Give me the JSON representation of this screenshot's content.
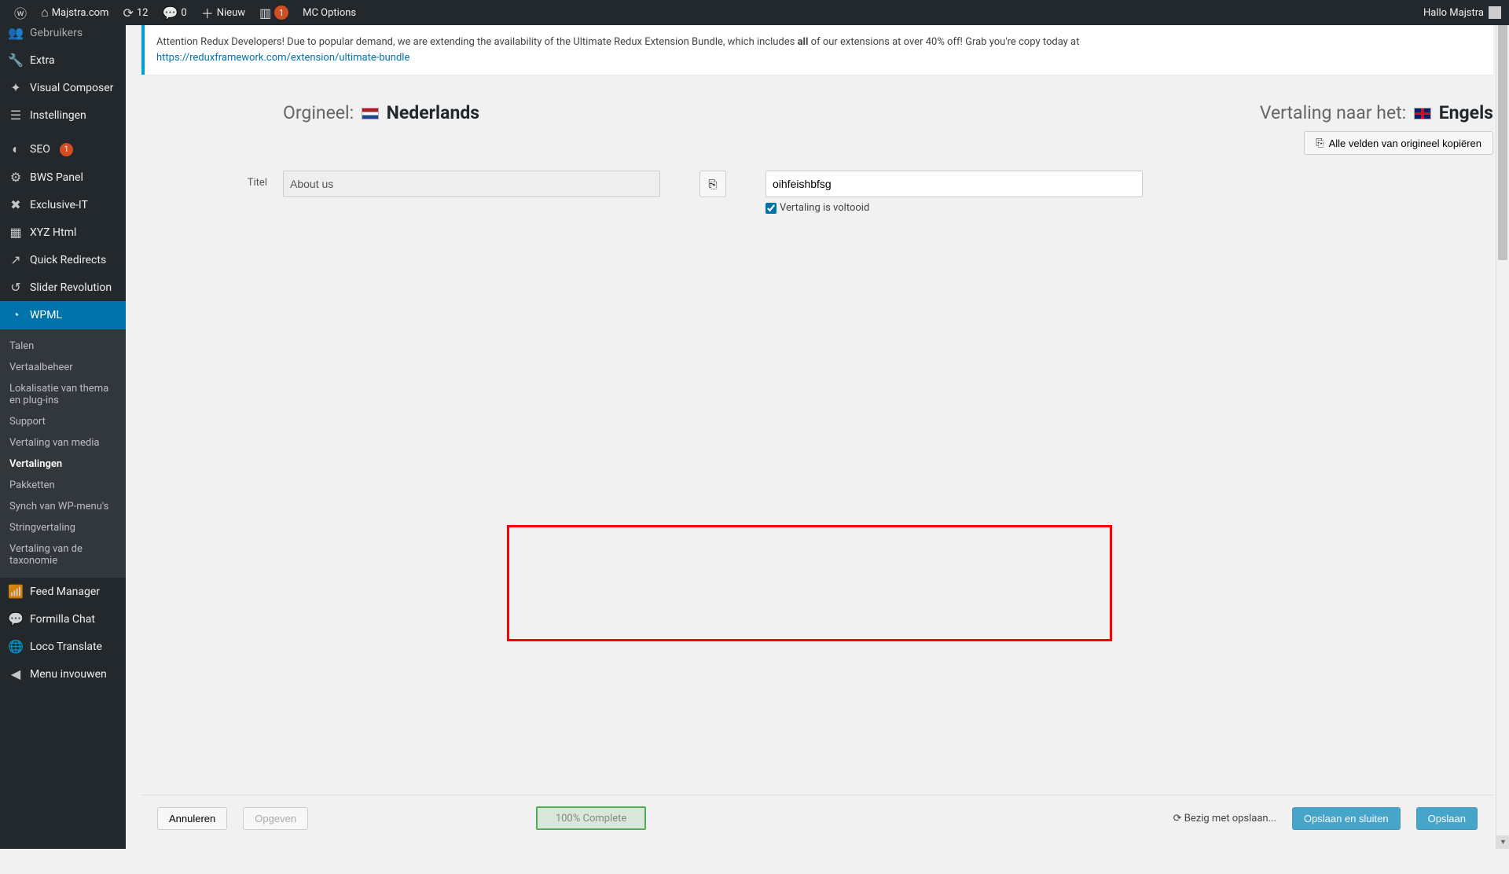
{
  "adminbar": {
    "site": "Majstra.com",
    "updates": "12",
    "comments": "0",
    "new": "Nieuw",
    "mc_badge": "1",
    "mc_options": "MC Options",
    "greeting": "Hallo Majstra"
  },
  "sidebar": {
    "items": [
      {
        "label": "Gebruikers",
        "icon": "👥",
        "partial": true
      },
      {
        "label": "Extra",
        "icon": "🔧"
      },
      {
        "label": "Visual Composer",
        "icon": "✦"
      },
      {
        "label": "Instellingen",
        "icon": "☰"
      }
    ],
    "items2": [
      {
        "label": "SEO",
        "icon": "◐",
        "badge": "1"
      },
      {
        "label": "BWS Panel",
        "icon": "⚙"
      },
      {
        "label": "Exclusive-IT",
        "icon": "✖"
      },
      {
        "label": "XYZ Html",
        "icon": "▦"
      },
      {
        "label": "Quick Redirects",
        "icon": "↗"
      },
      {
        "label": "Slider Revolution",
        "icon": "↺"
      },
      {
        "label": "WPML",
        "icon": "◔",
        "active": true
      }
    ],
    "submenu": [
      {
        "label": "Talen"
      },
      {
        "label": "Vertaalbeheer"
      },
      {
        "label": "Lokalisatie van thema en plug-ins"
      },
      {
        "label": "Support"
      },
      {
        "label": "Vertaling van media"
      },
      {
        "label": "Vertalingen",
        "current": true
      },
      {
        "label": "Pakketten"
      },
      {
        "label": "Synch van WP-menu's"
      },
      {
        "label": "Stringvertaling"
      },
      {
        "label": "Vertaling van de taxonomie"
      }
    ],
    "items3": [
      {
        "label": "Feed Manager",
        "icon": "📶"
      },
      {
        "label": "Formilla Chat",
        "icon": "💬"
      },
      {
        "label": "Loco Translate",
        "icon": "🌐"
      },
      {
        "label": "Menu invouwen",
        "icon": "◀"
      }
    ]
  },
  "notice": {
    "text1": "Attention Redux Developers! Due to popular demand, we are extending the availability of the Ultimate Redux Extension Bundle, which includes ",
    "bold": "all",
    "text2": " of our extensions at over 40% off! Grab you're copy today at ",
    "link": "https://reduxframework.com/extension/ultimate-bundle"
  },
  "translator": {
    "original_label": "Orgineel:",
    "original_lang": "Nederlands",
    "target_label": "Vertaling naar het:",
    "target_lang": "Engels",
    "copy_all": "Alle velden van origineel kopiëren",
    "field_title_label": "Titel",
    "field_title_value": "About us",
    "translation_value": "oihfeishbfsg",
    "complete_label": "Vertaling is voltooid"
  },
  "footer": {
    "cancel": "Annuleren",
    "giveup": "Opgeven",
    "progress": "100% Complete",
    "saving": "Bezig met opslaan...",
    "save_close": "Opslaan en sluiten",
    "save": "Opslaan"
  }
}
